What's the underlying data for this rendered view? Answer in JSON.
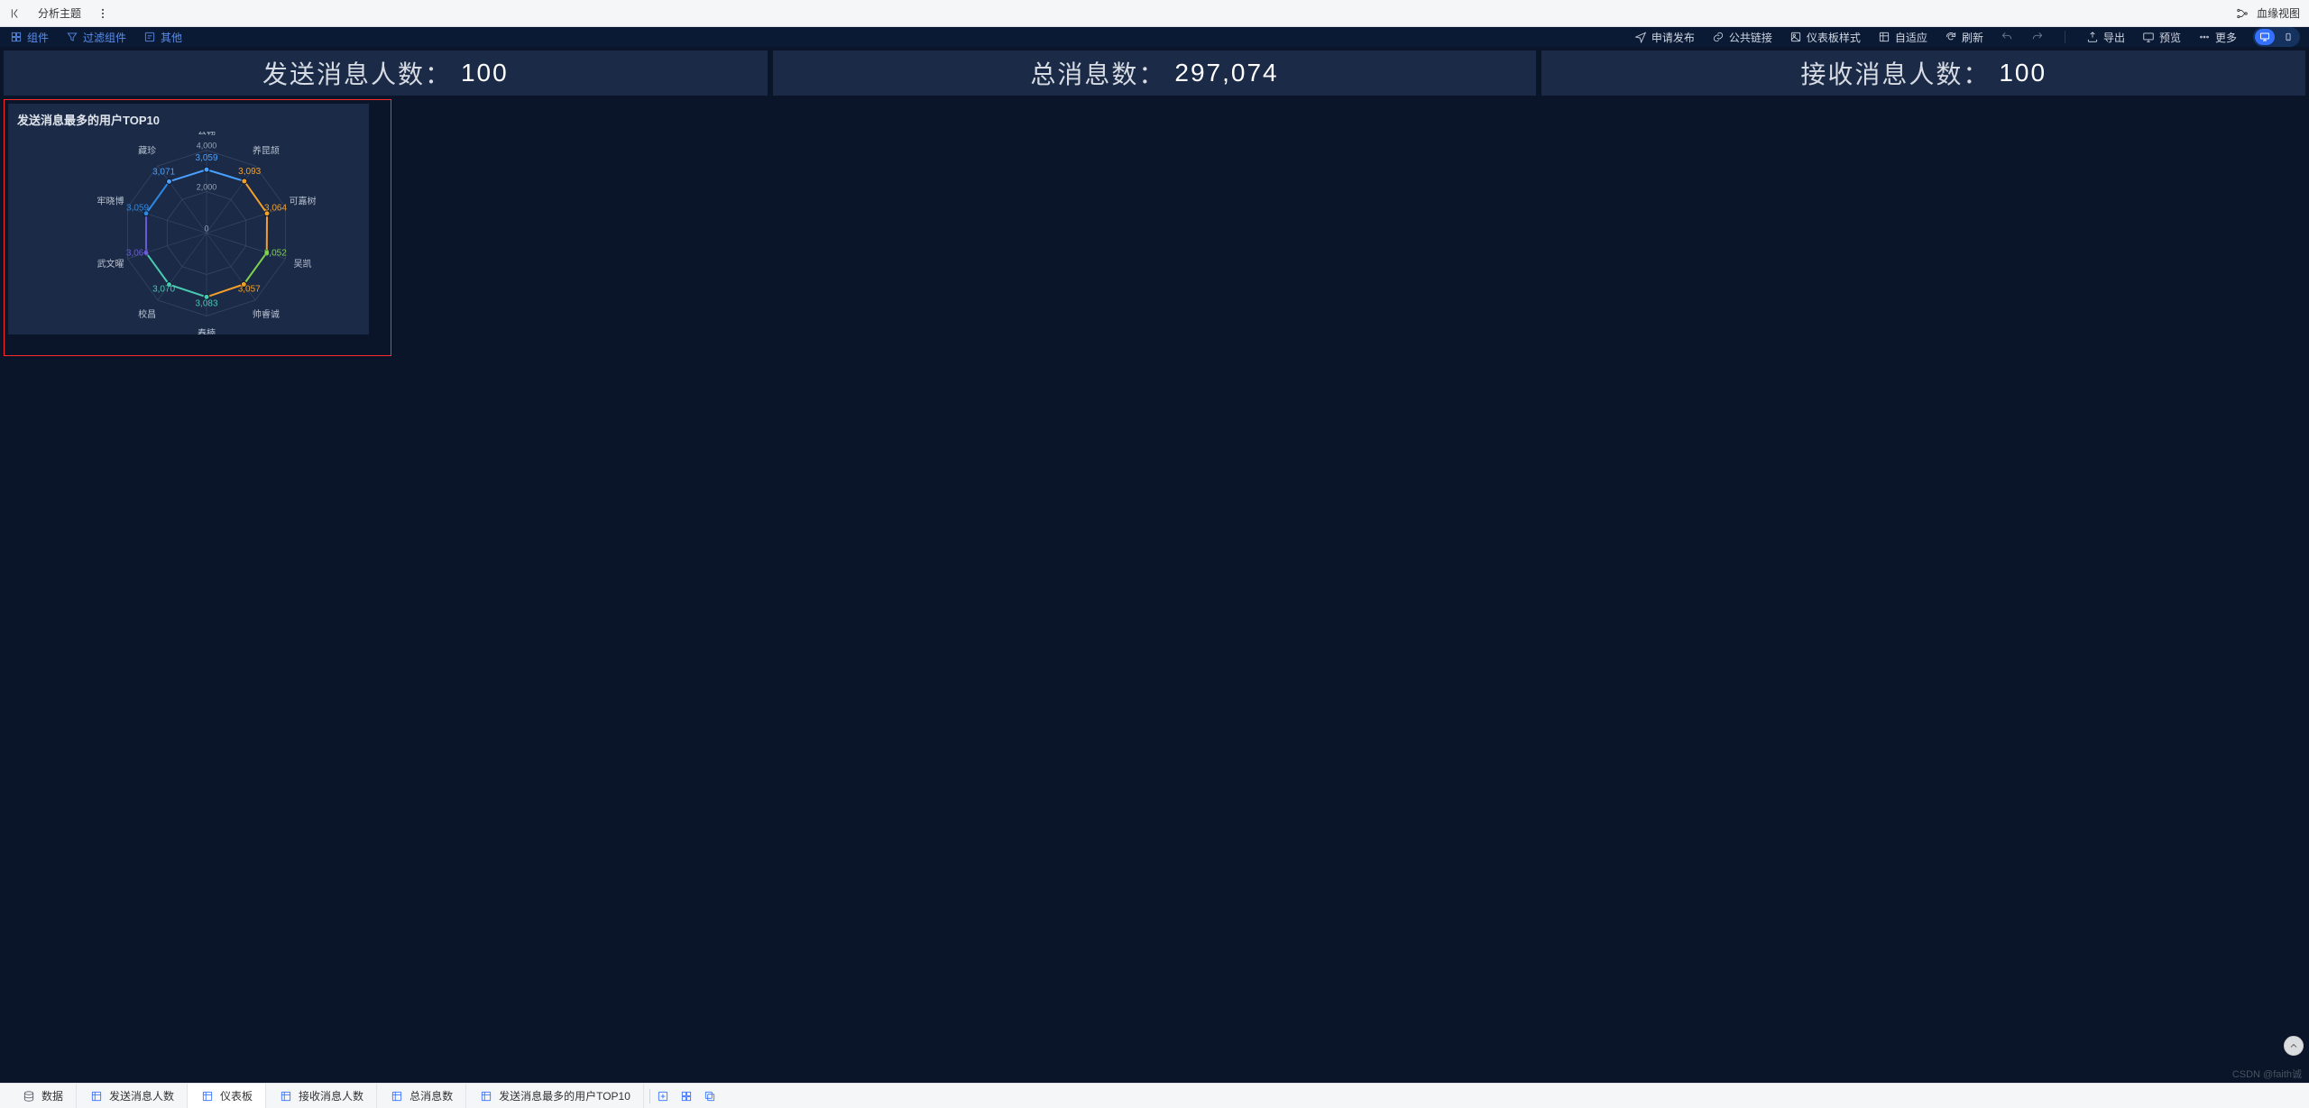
{
  "appbar": {
    "title": "分析主题",
    "lineage": "血缘视图"
  },
  "toolbar": {
    "left": [
      {
        "icon": "components-icon",
        "label": "组件"
      },
      {
        "icon": "filter-icon",
        "label": "过滤组件"
      },
      {
        "icon": "other-icon",
        "label": "其他"
      }
    ],
    "right": [
      {
        "icon": "send-icon",
        "label": "申请发布"
      },
      {
        "icon": "link-icon",
        "label": "公共链接"
      },
      {
        "icon": "style-icon",
        "label": "仪表板样式"
      },
      {
        "icon": "adapt-icon",
        "label": "自适应"
      },
      {
        "icon": "refresh-icon",
        "label": "刷新"
      }
    ],
    "right2": [
      {
        "icon": "export-icon",
        "label": "导出"
      },
      {
        "icon": "preview-icon",
        "label": "预览"
      },
      {
        "icon": "more-icon",
        "label": "更多"
      }
    ]
  },
  "kpi": [
    {
      "label": "发送消息人数：",
      "value": "100"
    },
    {
      "label": "总消息数：",
      "value": "297,074"
    },
    {
      "label": "接收消息人数：",
      "value": "100"
    }
  ],
  "chart_data": {
    "type": "radar",
    "title": "发送消息最多的用户TOP10",
    "max": 4000,
    "rings": [
      0,
      2000,
      4000
    ],
    "categories": [
      "公翱",
      "养昆颉",
      "可嘉树",
      "吴凯",
      "帅睿诚",
      "春楠",
      "校昌",
      "武文曜",
      "牢晓博",
      "藏珍"
    ],
    "values": [
      3059,
      3093,
      3064,
      3052,
      3057,
      3083,
      3070,
      3066,
      3059,
      3071
    ],
    "value_labels": [
      "3,059",
      "3,093",
      "3,064",
      "3,052",
      "3,057",
      "3,083",
      "3,070",
      "3,066",
      "3,059",
      "3,071"
    ],
    "colors": [
      "#4aa0ff",
      "#f2a02a",
      "#f2a02a",
      "#7ed24c",
      "#f2a02a",
      "#48c9b0",
      "#48c9b0",
      "#6b5bd6",
      "#2e86de",
      "#4aa0ff"
    ]
  },
  "bottom_tabs": [
    {
      "icon": "data-icon",
      "label": "数据",
      "active": false,
      "cls": "data"
    },
    {
      "icon": "sheet-icon",
      "label": "发送消息人数",
      "active": false
    },
    {
      "icon": "sheet-icon",
      "label": "仪表板",
      "active": true
    },
    {
      "icon": "sheet-icon",
      "label": "接收消息人数",
      "active": false
    },
    {
      "icon": "sheet-icon",
      "label": "总消息数",
      "active": false
    },
    {
      "icon": "sheet-icon",
      "label": "发送消息最多的用户TOP10",
      "active": false
    }
  ],
  "watermark": "CSDN @faith诚"
}
